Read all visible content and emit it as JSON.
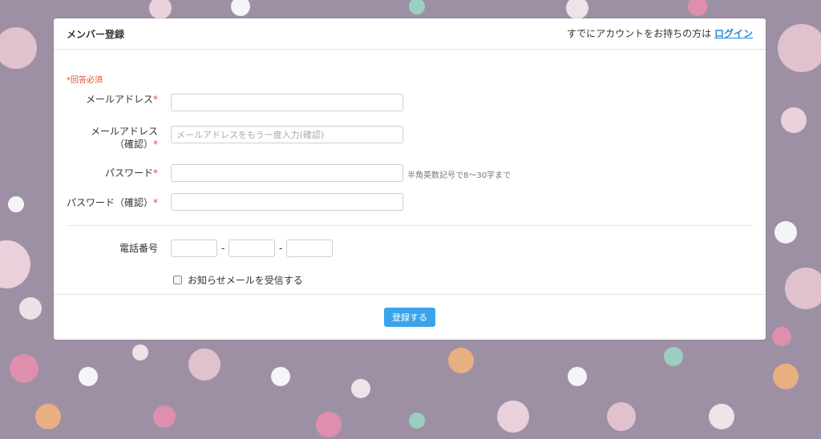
{
  "header": {
    "title": "メンバー登録",
    "login_hint": "すでにアカウントをお持ちの方は",
    "login_link": "ログイン"
  },
  "form": {
    "required_note": "*回答必須",
    "email_label": "メールアドレス",
    "email_confirm_label_line1": "メールアドレス",
    "email_confirm_label_line2": "（確認）",
    "email_confirm_placeholder": "メールアドレスをもう一度入力(確認)",
    "password_label": "パスワード",
    "password_hint": "半角英数記号で8〜30字まで",
    "password_confirm_label": "パスワード（確認）",
    "phone_label": "電話番号",
    "phone_separator": "-",
    "newsletter_label": "お知らせメールを受信する",
    "required_mark": "*",
    "submit_label": "登録する"
  },
  "colors": {
    "accent": "#3ba3ea",
    "link": "#1a8cd8",
    "required": "#e0502c",
    "background": "#9d90a4"
  }
}
